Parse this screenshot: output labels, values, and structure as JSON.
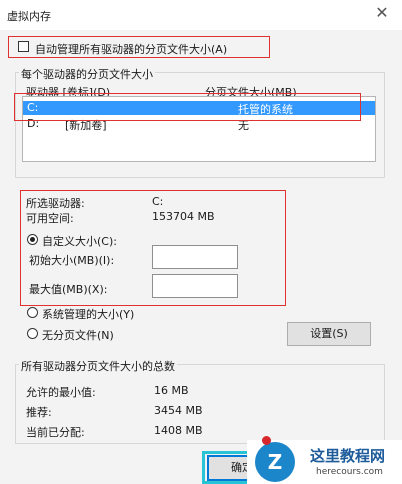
{
  "window": {
    "title": "虚拟内存",
    "close_glyph": "✕"
  },
  "auto_manage": {
    "label": "自动管理所有驱动器的分页文件大小(A)",
    "checked": false
  },
  "drives_group": {
    "legend": "每个驱动器的分页文件大小",
    "header_drive": "驱动器 [卷标](D)",
    "header_size": "分页文件大小(MB)",
    "rows": [
      {
        "drive": "C:",
        "label": "",
        "size": "托管的系统",
        "selected": true
      },
      {
        "drive": "D:",
        "label": "[新加卷]",
        "size": "无",
        "selected": false
      }
    ]
  },
  "selected_drive": {
    "label": "所选驱动器:",
    "value": "C:",
    "space_label": "可用空间:",
    "space_value": "153704 MB"
  },
  "custom": {
    "label": "自定义大小(C):",
    "checked": true,
    "initial_label": "初始大小(MB)(I):",
    "initial_value": "",
    "max_label": "最大值(MB)(X):",
    "max_value": ""
  },
  "system_managed": {
    "label": "系统管理的大小(Y)",
    "checked": false
  },
  "no_paging": {
    "label": "无分页文件(N)",
    "checked": false
  },
  "set_button": "设置(S)",
  "totals": {
    "legend": "所有驱动器分页文件大小的总数",
    "min_label": "允许的最小值:",
    "min_value": "16 MB",
    "rec_label": "推荐:",
    "rec_value": "3454 MB",
    "cur_label": "当前已分配:",
    "cur_value": "1408 MB"
  },
  "confirm_button": "确定",
  "watermark": {
    "title": "这里教程网",
    "url": "herecours.com",
    "letter": "Z"
  },
  "colors": {
    "selection": "#3399ff",
    "highlight_red": "#e0312f",
    "highlight_cyan": "#28c3d4"
  }
}
